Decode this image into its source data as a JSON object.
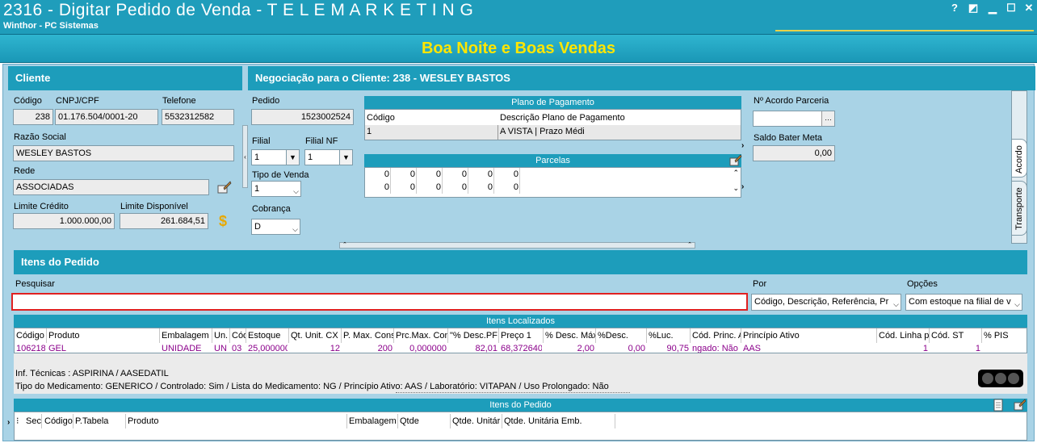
{
  "window": {
    "title": "2316 - Digitar Pedido de Venda - T E L E M A R K E T I N G",
    "subtitle": "Winthor - PC Sistemas",
    "controls": [
      "?",
      "◩",
      "▁",
      "☐",
      "✕"
    ]
  },
  "greeting": "Boa Noite e Boas Vendas",
  "cliente": {
    "header": "Cliente",
    "codigo_label": "Código",
    "codigo": "238",
    "cnpj_label": "CNPJ/CPF",
    "cnpj": "01.176.504/0001-20",
    "telefone_label": "Telefone",
    "telefone": "5532312582",
    "razao_label": "Razão Social",
    "razao": "WESLEY BASTOS",
    "rede_label": "Rede",
    "rede": "ASSOCIADAS",
    "limite_credito_label": "Limite Crédito",
    "limite_credito": "1.000.000,00",
    "limite_disp_label": "Limite Disponível",
    "limite_disp": "261.684,51"
  },
  "negociacao": {
    "header": "Negociação para o Cliente: 238 - WESLEY BASTOS",
    "pedido_label": "Pedido",
    "pedido": "1523002524",
    "filial_label": "Filial",
    "filial": "1",
    "filial_nf_label": "Filial NF",
    "filial_nf": "1",
    "tipo_venda_label": "Tipo de Venda",
    "tipo_venda": "1",
    "cobranca_label": "Cobrança",
    "cobranca": "D"
  },
  "plano": {
    "header": "Plano de Pagamento",
    "col_codigo": "Código",
    "col_desc": "Descrição Plano de Pagamento",
    "row_codigo": "1",
    "row_desc": "A VISTA | Prazo Médi"
  },
  "parcelas": {
    "header": "Parcelas",
    "rows": [
      [
        "0",
        "0",
        "0",
        "0",
        "0",
        "0"
      ],
      [
        "0",
        "0",
        "0",
        "0",
        "0",
        "0"
      ]
    ]
  },
  "acordo": {
    "label": "Nº Acordo Parceria",
    "value": "",
    "saldo_label": "Saldo Bater Meta",
    "saldo": "0,00",
    "tab_acordo": "Acordo",
    "tab_transporte": "Transporte"
  },
  "itens": {
    "header": "Itens do Pedido",
    "pesquisar_label": "Pesquisar",
    "pesquisar": "",
    "por_label": "Por",
    "por": "Código, Descrição, Referência, Pr",
    "opcoes_label": "Opções",
    "opcoes": "Com estoque na filial de v"
  },
  "localizados": {
    "header": "Itens Localizados",
    "columns": [
      "Código",
      "Produto",
      "Embalagem",
      "Un.",
      "Cód",
      "Estoque",
      "Qt. Unit. CX",
      "P. Max. Cons",
      "Prc.Max. Con",
      "\"% Desc.PF",
      "Preço 1",
      "% Desc. Máx",
      "%Desc.",
      "%Luc.",
      "Cód. Princ. A",
      "Princípio Ativo",
      "Cód. Linha pr",
      "Cód. ST",
      "% PIS"
    ],
    "row": [
      "106218",
      "GEL",
      "UNIDADE",
      "UN",
      "03",
      "25,000000",
      "12",
      "200",
      "0,000000",
      "82,01",
      "68,372640",
      "2,00",
      "0,00",
      "90,75",
      "ngado: Não",
      "AAS",
      "1",
      "1",
      ""
    ]
  },
  "info": {
    "line1": "Inf. Técnicas : ASPIRINA / AASEDATIL",
    "line2": "Tipo do Medicamento: GENERICO / Controlado: Sim / Lista do Medicamento: NG / Princípio Ativo: AAS / Laboratório: VITAPAN / Uso Prolongado: Não"
  },
  "pedido_itens": {
    "header": "Itens do Pedido",
    "columns": [
      "Sec",
      "Código",
      "P.Tabela",
      "Produto",
      "Embalagem",
      "Qtde",
      "Qtde. Unitár",
      "Qtde. Unitária Emb."
    ]
  },
  "colors": {
    "title": "#1f9dbb",
    "greeting_text": "#ffe600",
    "panel": "#a9d3e6",
    "search_border": "#e02020",
    "row_text": "#8b008b"
  }
}
